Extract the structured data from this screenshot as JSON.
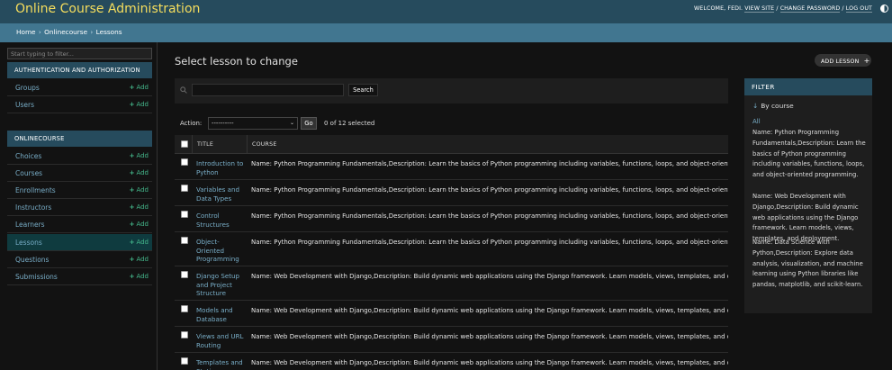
{
  "header": {
    "branding": "Online Course Administration",
    "welcome": "WELCOME, FEDI.",
    "view_site": "VIEW SITE",
    "change_password": "CHANGE PASSWORD",
    "logout": "LOG OUT",
    "separator": "/"
  },
  "breadcrumbs": [
    "Home",
    "Onlinecourse",
    "Lessons"
  ],
  "sidebar": {
    "filter_placeholder": "Start typing to filter...",
    "auth_caption": "AUTHENTICATION AND AUTHORIZATION",
    "auth_models": [
      {
        "name": "Groups",
        "add": "Add"
      },
      {
        "name": "Users",
        "add": "Add"
      }
    ],
    "app_caption": "ONLINECOURSE",
    "app_models": [
      {
        "name": "Choices",
        "add": "Add"
      },
      {
        "name": "Courses",
        "add": "Add"
      },
      {
        "name": "Enrollments",
        "add": "Add"
      },
      {
        "name": "Instructors",
        "add": "Add"
      },
      {
        "name": "Learners",
        "add": "Add"
      },
      {
        "name": "Lessons",
        "add": "Add",
        "active": true
      },
      {
        "name": "Questions",
        "add": "Add"
      },
      {
        "name": "Submissions",
        "add": "Add"
      }
    ]
  },
  "main": {
    "title": "Select lesson to change",
    "add_button": "ADD LESSON",
    "search_button": "Search",
    "action_label": "Action:",
    "action_selected": "----------",
    "go_button": "Go",
    "counter": "0 of 12 selected",
    "columns": [
      "TITLE",
      "COURSE"
    ],
    "rows": [
      {
        "title": "Introduction to Python",
        "course": "Name: Python Programming Fundamentals,Description: Learn the basics of Python programming including variables, functions, loops, and object-oriented pro"
      },
      {
        "title": "Variables and Data Types",
        "course": "Name: Python Programming Fundamentals,Description: Learn the basics of Python programming including variables, functions, loops, and object-oriented pro"
      },
      {
        "title": "Control Structures",
        "course": "Name: Python Programming Fundamentals,Description: Learn the basics of Python programming including variables, functions, loops, and object-oriented pro"
      },
      {
        "title": "Object-Oriented Programming",
        "course": "Name: Python Programming Fundamentals,Description: Learn the basics of Python programming including variables, functions, loops, and object-oriented pro"
      },
      {
        "title": "Django Setup and Project Structure",
        "course": "Name: Web Development with Django,Description: Build dynamic web applications using the Django framework. Learn models, views, templates, and deploy"
      },
      {
        "title": "Models and Database",
        "course": "Name: Web Development with Django,Description: Build dynamic web applications using the Django framework. Learn models, views, templates, and deploy"
      },
      {
        "title": "Views and URL Routing",
        "course": "Name: Web Development with Django,Description: Build dynamic web applications using the Django framework. Learn models, views, templates, and deploy"
      },
      {
        "title": "Templates and Static",
        "course": "Name: Web Development with Django,Description: Build dynamic web applications using the Django framework. Learn models, views, templates, and deploy"
      }
    ]
  },
  "filter": {
    "title": "FILTER",
    "by": "By course",
    "all": "All",
    "options": [
      "Name: Python Programming Fundamentals,Description: Learn the basics of Python programming including variables, functions, loops, and object-oriented programming.",
      "Name: Web Development with Django,Description: Build dynamic web applications using the Django framework. Learn models, views, templates, and deployment.",
      "Name: Data Science with Python,Description: Explore data analysis, visualization, and machine learning using Python libraries like pandas, matplotlib, and scikit-learn."
    ]
  },
  "colors": {
    "header_bg": "#264b5d",
    "breadcrumb_bg": "#417690",
    "branding": "#f5dd5d",
    "link": "#79aec8",
    "add": "#44b78b",
    "active_row": "#0f3b3f"
  }
}
